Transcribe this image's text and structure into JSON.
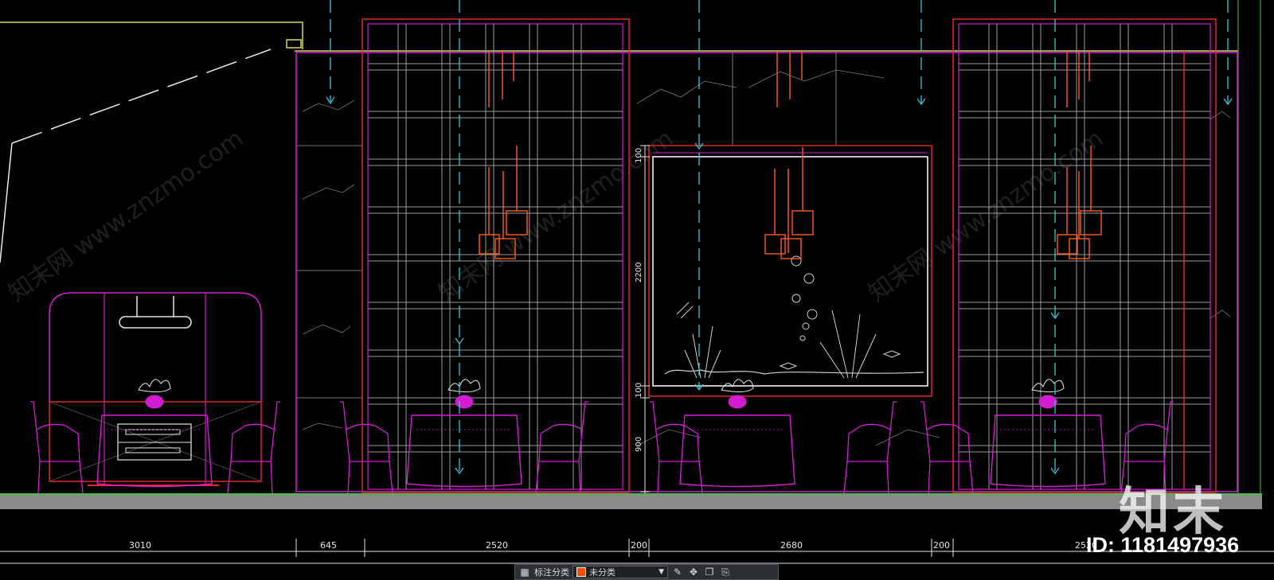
{
  "drawing": {
    "horizontal_dims": [
      "3010",
      "645",
      "2520",
      "200",
      "2680",
      "200",
      "2520"
    ],
    "vertical_dims": [
      "100",
      "2200",
      "100",
      "900"
    ],
    "watermark_text": "知末网 www.znzmo.com"
  },
  "toolbar": {
    "label": "标注分类",
    "select_value": "未分类",
    "swatch_color": "#ff4d00"
  },
  "branding": {
    "logo_text": "知末",
    "id_text": "ID: 1181497936"
  },
  "colors": {
    "magenta": "#d21cd2",
    "red": "#e0282a",
    "cyan": "#34c6d8",
    "green": "#46c048",
    "yellow": "#d8d45a",
    "gray": "#9a9a9a",
    "orange": "#ff5a1f"
  }
}
